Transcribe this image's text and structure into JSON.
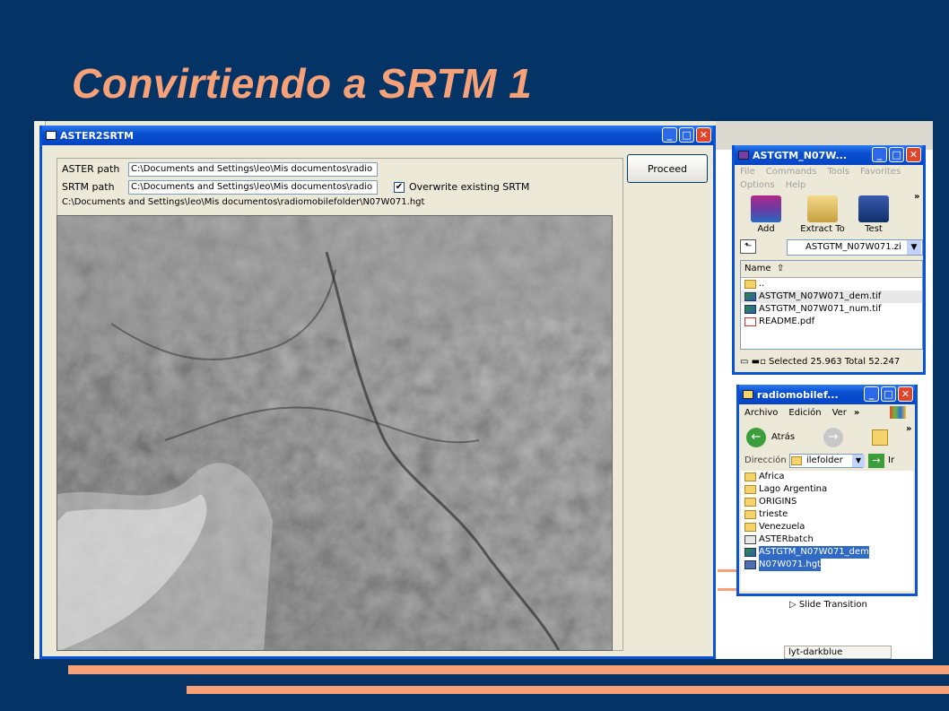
{
  "slide": {
    "title": "Convirtiendo a SRTM 1"
  },
  "aster_window": {
    "title": "ASTER2SRTM",
    "aster_path_label": "ASTER path",
    "aster_path_value": "C:\\Documents and Settings\\leo\\Mis documentos\\radio",
    "srtm_path_label": "SRTM path",
    "srtm_path_value": "C:\\Documents and Settings\\leo\\Mis documentos\\radio",
    "overwrite_label": "Overwrite existing SRTM",
    "overwrite_check": "✔",
    "output_path": "C:\\Documents and Settings\\leo\\Mis documentos\\radiomobilefolder\\N07W071.hgt",
    "proceed_label": "Proceed"
  },
  "winrar_window": {
    "title": "ASTGTM_N07W...",
    "menu": [
      "File",
      "Commands",
      "Tools",
      "Favorites",
      "Options",
      "Help"
    ],
    "toolbar": [
      "Add",
      "Extract To",
      "Test"
    ],
    "path_value": "ASTGTM_N07W071.zi",
    "column_name": "Name",
    "files": [
      "..",
      "ASTGTM_N07W071_dem.tif",
      "ASTGTM_N07W071_num.tif",
      "README.pdf"
    ],
    "status": "Selected 25.963  Total 52.247"
  },
  "explorer_window": {
    "title": "radiomobilef...",
    "menu": [
      "Archivo",
      "Edición",
      "Ver"
    ],
    "back_label": "Atrás",
    "address_label": "Dirección",
    "address_value": "ilefolder",
    "go_label": "Ir",
    "items": [
      "Africa",
      "Lago Argentina",
      "ORIGINS",
      "trieste",
      "Venezuela",
      "ASTERbatch",
      "ASTGTM_N07W071_dem",
      "N07W071.hgt"
    ]
  },
  "background_app": {
    "slide_transition": "Slide Transition",
    "status_text": "lyt-darkblue"
  },
  "colors": {
    "slide_bg": "#043466",
    "accent": "#F7A178",
    "xp_blue": "#0a52d6"
  }
}
